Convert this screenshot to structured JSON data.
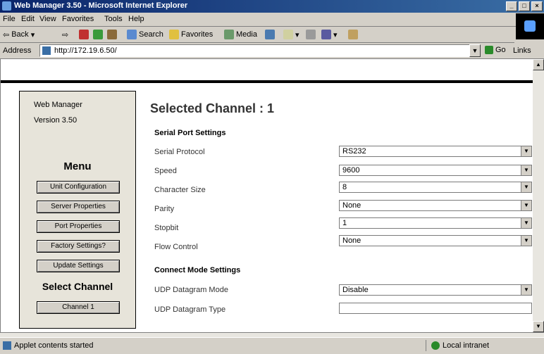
{
  "window": {
    "title": "Web Manager 3.50 - Microsoft Internet Explorer"
  },
  "menubar": [
    "File",
    "Edit",
    "View",
    "Favorites",
    "Tools",
    "Help"
  ],
  "toolbar": {
    "back": "Back",
    "search": "Search",
    "favorites": "Favorites",
    "media": "Media"
  },
  "address": {
    "label": "Address",
    "url": "http://172.19.6.50/",
    "go": "Go",
    "links": "Links"
  },
  "sidebar": {
    "app_name": "Web Manager",
    "version": "Version 3.50",
    "menu_title": "Menu",
    "buttons": [
      "Unit Configuration",
      "Server Properties",
      "Port Properties",
      "Factory Settings?",
      "Update Settings"
    ],
    "select_title": "Select Channel",
    "channel_button": "Channel 1"
  },
  "main": {
    "title": "Selected Channel : 1",
    "serial_section": "Serial Port Settings",
    "connect_section": "Connect Mode Settings",
    "fields": [
      {
        "label": "Serial Protocol",
        "value": "RS232"
      },
      {
        "label": "Speed",
        "value": "9600"
      },
      {
        "label": "Character Size",
        "value": "8"
      },
      {
        "label": "Parity",
        "value": "None"
      },
      {
        "label": "Stopbit",
        "value": "1"
      },
      {
        "label": "Flow Control",
        "value": "None"
      }
    ],
    "udp_mode": {
      "label": "UDP Datagram Mode",
      "value": "Disable"
    },
    "udp_type": {
      "label": "UDP Datagram Type",
      "value": ""
    }
  },
  "status": {
    "left": "Applet contents started",
    "right": "Local intranet"
  }
}
